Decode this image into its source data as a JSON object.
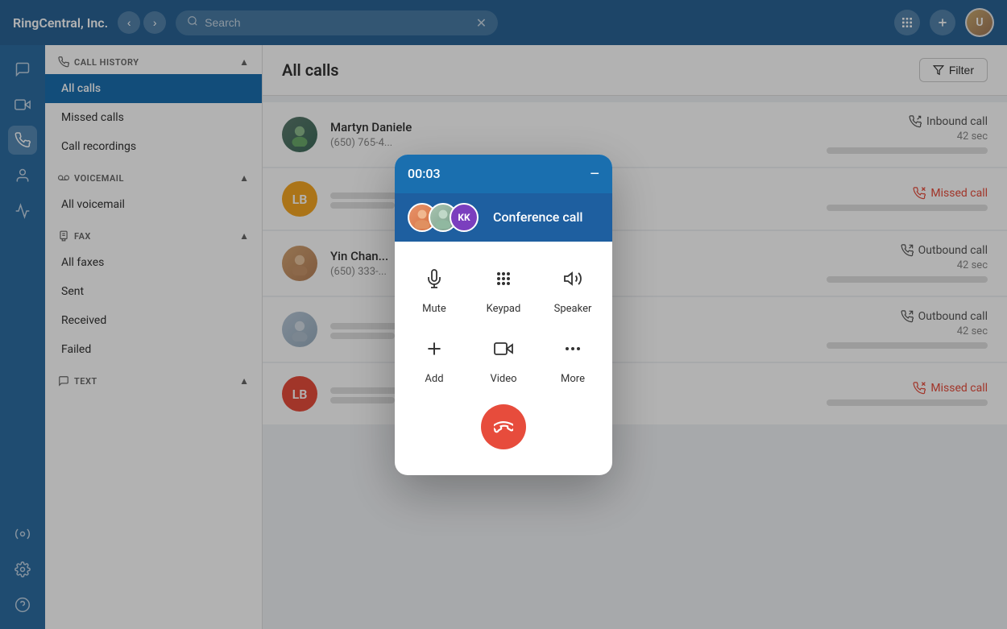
{
  "app": {
    "title": "RingCentral, Inc.",
    "search_placeholder": "Search"
  },
  "topbar": {
    "back_label": "‹",
    "forward_label": "›",
    "clear_label": "✕"
  },
  "sidebar": {
    "call_history_label": "CALL HISTORY",
    "items_call": [
      {
        "label": "All calls",
        "active": true
      },
      {
        "label": "Missed calls",
        "active": false
      },
      {
        "label": "Call recordings",
        "active": false
      }
    ],
    "voicemail_label": "VOICEMAIL",
    "items_voicemail": [
      {
        "label": "All voicemail",
        "active": false
      }
    ],
    "fax_label": "FAX",
    "items_fax": [
      {
        "label": "All faxes",
        "active": false
      },
      {
        "label": "Sent",
        "active": false
      },
      {
        "label": "Received",
        "active": false
      },
      {
        "label": "Failed",
        "active": false
      }
    ],
    "text_label": "TEXT"
  },
  "main": {
    "title": "All calls",
    "filter_label": "Filter"
  },
  "calls": [
    {
      "id": 1,
      "name": "Martyn Daniele",
      "number": "(650) 765-4...",
      "type": "Inbound call",
      "missed": false,
      "duration": "42 sec",
      "avatar_type": "image",
      "avatar_color": ""
    },
    {
      "id": 2,
      "name": "",
      "number": "",
      "type": "Missed call",
      "missed": true,
      "duration": "",
      "avatar_type": "initials",
      "initials": "LB",
      "avatar_color": "#f5a623"
    },
    {
      "id": 3,
      "name": "Yin Chan...",
      "number": "(650) 333-...",
      "type": "Outbound call",
      "missed": false,
      "duration": "42 sec",
      "avatar_type": "image",
      "avatar_color": ""
    },
    {
      "id": 4,
      "name": "",
      "number": "",
      "type": "Outbound call",
      "missed": false,
      "duration": "42 sec",
      "avatar_type": "image",
      "avatar_color": ""
    },
    {
      "id": 5,
      "name": "",
      "number": "",
      "type": "Missed call",
      "missed": true,
      "duration": "",
      "avatar_type": "initials",
      "initials": "LB",
      "avatar_color": "#e74c3c"
    }
  ],
  "call_modal": {
    "timer": "00:03",
    "minimize_label": "−",
    "conference_label": "Conference call",
    "participant1_initials": "KK",
    "controls": [
      {
        "label": "Mute",
        "icon": "mute"
      },
      {
        "label": "Keypad",
        "icon": "keypad"
      },
      {
        "label": "Speaker",
        "icon": "speaker"
      },
      {
        "label": "Add",
        "icon": "add"
      },
      {
        "label": "Video",
        "icon": "video"
      },
      {
        "label": "More",
        "icon": "more"
      }
    ],
    "end_call_label": "end-call"
  }
}
